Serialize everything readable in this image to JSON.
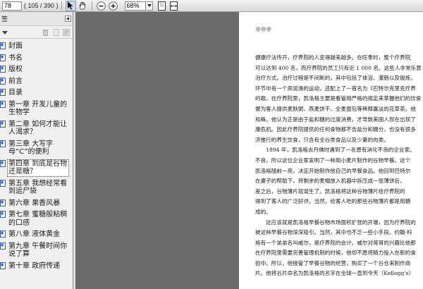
{
  "toolbar": {
    "page_input": "78",
    "page_info": "( 105 / 390 )",
    "zoom": "68%"
  },
  "sidebar": {
    "title": "签",
    "items": [
      {
        "label": "封面"
      },
      {
        "label": "书名"
      },
      {
        "label": "版权"
      },
      {
        "label": "前言"
      },
      {
        "label": "目录"
      },
      {
        "label": "第一章  开发儿童的生物学"
      },
      {
        "label": "第二章  如何才能让人渴求？"
      },
      {
        "label": "第三章  大写字母“C”的便利"
      },
      {
        "label": "第四章  到底是谷物还是糖？"
      },
      {
        "label": "第五章  我想经常看到运尸袋"
      },
      {
        "label": "第六章  果香风暴"
      },
      {
        "label": "第七章  蜜糖般粘稠的口感"
      },
      {
        "label": "第八章  液体黄金"
      },
      {
        "label": "第九章  午餐时间你说了算"
      },
      {
        "label": "第十章  政府传递"
      }
    ]
  },
  "document": {
    "header": "@@@",
    "paragraphs": [
      "健康疗法传开，疗养院的人变得越来越多。在旺季时，整个疗养院",
      "可以达到 400 名，而疗养院的员工只有近 1 000 名。这些人非常乐意",
      "治疗方式。治疗过程是不间断的，其中包括了体浴、灌肠以及锻炼。",
      "环节中有一个高润滑的运动，还配上了一首名为《巴特尔克里克疗养",
      "的歌。在疗养院里，凯洛格主要是看管用严格的规定来掌握他们的饮食",
      "督为客人提供麦麸粥、燕麦饼干、全麦面包等稀释寡淡的花草茶。他",
      "和蛛，他认为正是由于盐和糖的过度消费，才导致美国人现在出现了",
      "康危机。因此疗养院提供的任何食物都不含盐分和糖分，也没有很多",
      "济推行的养生饮食，只含有全谷类食品以及少量的肉类。",
      "　　1894 年，凯洛格去丹佛时遇到了一名患有消化不良的企业家。",
      "不良，所以这位企业家发明了一种用小麦片制作的谷物早餐。这个",
      "凯洛格随前一亮，决定开始制作他自己的早餐食品。他回到巴特尔",
      "在妻子的帮助下，将剩余的麦帽放入机器中拆压成一张薄饼后，",
      "差之后，谷物薄片就诞生了。凯洛格将这种谷物薄片给疗养院的",
      "得到了客人的广泛好评。当然，给客人吃的那些谷物薄片都是用糖",
      "成的。",
      "　　这应该就是凯洛格早餐谷物市场面积扩张的开端，因为疗养院的",
      "被这种早餐谷物深深吸引。当然，其中也不乏一些小手段。约翰·科",
      "格有一个弟弟名叫威尔，是疗养院的会计。威尔对哥哥的兴趣比他那",
      "在疗养院里需要完善管理机制的时候，他却不愿将精力投入在新的食",
      "验中。所以，他接管了早餐谷物的经营，购买了一个谷仓来制作商",
      "片。他将谷片命名为凯洛格的名字在全球一直到今天（Kellogg's）"
    ]
  }
}
